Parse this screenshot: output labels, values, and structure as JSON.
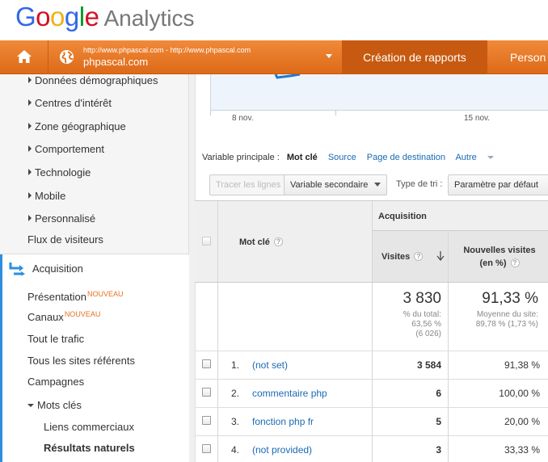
{
  "logo": {
    "google": [
      "G",
      "o",
      "o",
      "g",
      "l",
      "e"
    ],
    "product": "Analytics"
  },
  "nav": {
    "account_url": "http://www.phpascal.com - http://www.phpascal.com",
    "account_name": "phpascal.com",
    "active_tab": "Création de rapports",
    "next_tab": "Person"
  },
  "sidebar": {
    "items": [
      {
        "label": "Données démographiques"
      },
      {
        "label": "Centres d'intérêt"
      },
      {
        "label": "Zone géographique"
      },
      {
        "label": "Comportement"
      },
      {
        "label": "Technologie"
      },
      {
        "label": "Mobile"
      },
      {
        "label": "Personnalisé"
      }
    ],
    "flux": "Flux de visiteurs",
    "acquisition": "Acquisition",
    "presentation": "Présentation",
    "canaux": "Canaux",
    "new_badge": "NOUVEAU",
    "tout_trafic": "Tout le trafic",
    "sites_referents": "Tous les sites référents",
    "campagnes": "Campagnes",
    "mots_cles": "Mots clés",
    "liens_commerciaux": "Liens commerciaux",
    "resultats_naturels": "Résultats naturels"
  },
  "chart": {
    "ticks": [
      "8 nov.",
      "15 nov."
    ]
  },
  "dimension": {
    "label": "Variable principale :",
    "active": "Mot clé",
    "links": [
      "Source",
      "Page de destination"
    ],
    "other": "Autre"
  },
  "controls": {
    "plot_rows": "Tracer les lignes",
    "secondary": "Variable secondaire",
    "sort_type_label": "Type de tri :",
    "sort_default": "Paramètre par défaut"
  },
  "table": {
    "group_header": "Acquisition",
    "col_keyword": "Mot clé",
    "col_visits": "Visites",
    "col_new_visits_1": "Nouvelles visites",
    "col_new_visits_2": "(en %)",
    "totals": {
      "visits": "3 830",
      "visits_sub_1": "% du total:",
      "visits_sub_2": "63,56 %",
      "visits_sub_3": "(6 026)",
      "new": "91,33 %",
      "new_sub_1": "Moyenne du site:",
      "new_sub_2": "89,78 % (1,73 %)"
    },
    "rows": [
      {
        "index": "1.",
        "keyword": "(not set)",
        "visits": "3 584",
        "new": "91,38 %"
      },
      {
        "index": "2.",
        "keyword": "commentaire php",
        "visits": "6",
        "new": "100,00 %"
      },
      {
        "index": "3.",
        "keyword": "fonction php fr",
        "visits": "5",
        "new": "20,00 %"
      },
      {
        "index": "4.",
        "keyword": "(not provided)",
        "visits": "3",
        "new": "33,33 %"
      }
    ]
  },
  "colors": {
    "brand_orange": "#e8711f",
    "accent_blue": "#2d8fe0",
    "link": "#1a6ab2"
  }
}
